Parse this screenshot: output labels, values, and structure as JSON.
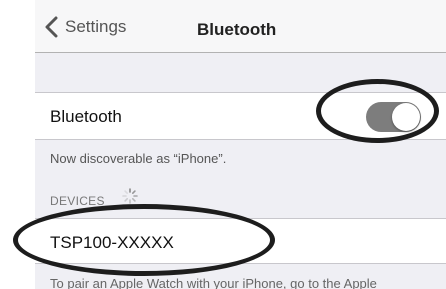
{
  "navbar": {
    "back_label": "Settings",
    "title": "Bluetooth"
  },
  "bluetooth": {
    "label": "Bluetooth",
    "enabled": true,
    "discoverable_text": "Now discoverable as “iPhone”."
  },
  "devices": {
    "section_label": "DEVICES",
    "items": [
      {
        "name": "TSP100-XXXXX"
      }
    ],
    "footer_text": "To pair an Apple Watch with your iPhone, go to the Apple"
  },
  "colors": {
    "toggle_on": "#7d7d7d",
    "highlight_ring": "#1d1d1d"
  }
}
